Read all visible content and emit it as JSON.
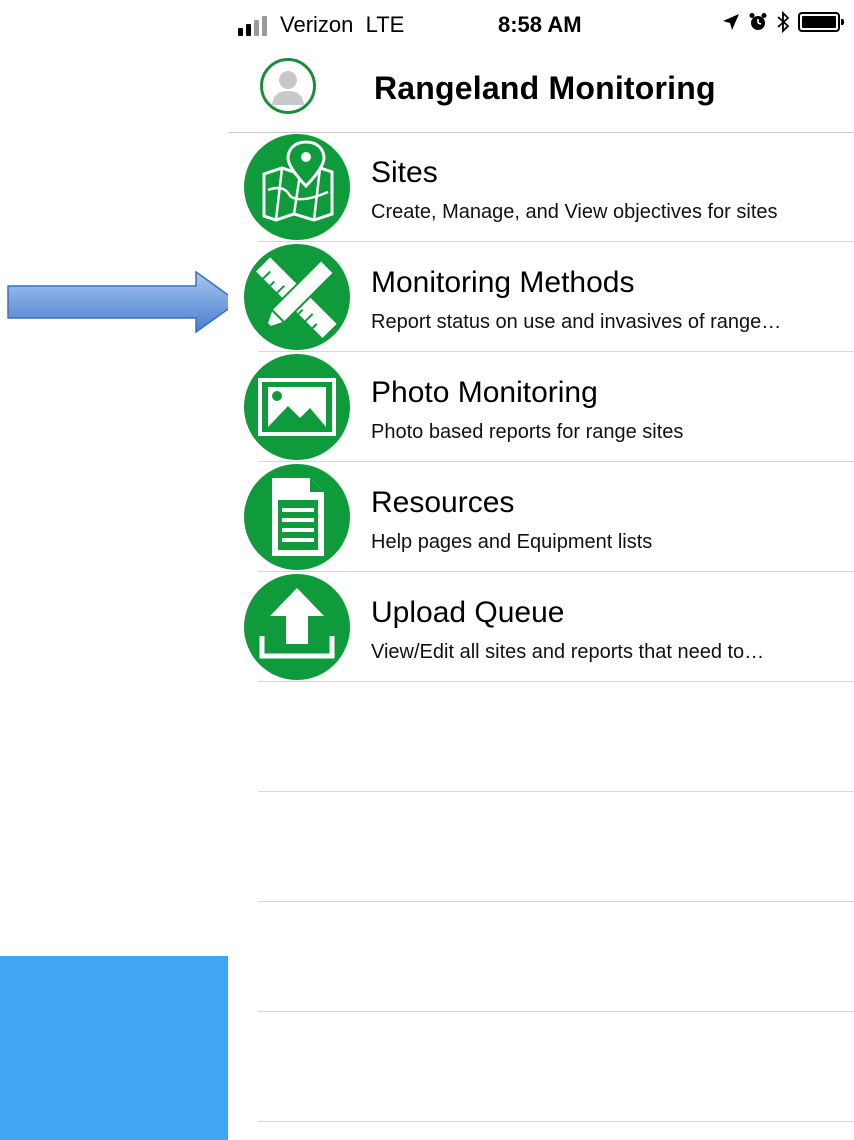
{
  "status_bar": {
    "carrier": "Verizon",
    "network": "LTE",
    "time": "8:58 AM"
  },
  "nav": {
    "title": "Rangeland Monitoring"
  },
  "menu": [
    {
      "title": "Sites",
      "subtitle": "Create, Manage, and View objectives for sites",
      "icon": "map-pin-icon"
    },
    {
      "title": "Monitoring Methods",
      "subtitle": "Report status on use and invasives of range…",
      "icon": "ruler-pencil-icon"
    },
    {
      "title": "Photo Monitoring",
      "subtitle": "Photo based reports for range sites",
      "icon": "photo-icon"
    },
    {
      "title": "Resources",
      "subtitle": "Help pages and Equipment lists",
      "icon": "document-icon"
    },
    {
      "title": "Upload Queue",
      "subtitle": "View/Edit all sites and reports that need to…",
      "icon": "upload-icon"
    }
  ],
  "colors": {
    "icon_green": "#0f9a3b",
    "annotation_blue": "#41a5f5",
    "arrow_blue": "#5b8fd8"
  }
}
